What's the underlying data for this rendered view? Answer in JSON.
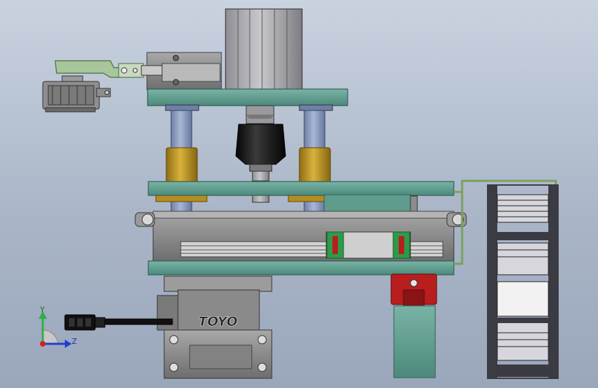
{
  "scene": {
    "brand_label": "TOYO",
    "triad": {
      "y_label": "Y",
      "z_label": "Z"
    },
    "colors": {
      "background_top": "#c9d2df",
      "background_bottom": "#9aa6ba",
      "plate_teal": "#5c9a8c",
      "plate_edge": "#2f5f55",
      "metal_gray": "#8c8c8c",
      "rod_blue": "#8fa0c4",
      "bushing_gold": "#c39a2c",
      "chuck_black": "#141414",
      "block_red": "#b81e1e",
      "accent_green": "#2f9a4a",
      "clamp_green": "#a7c79a",
      "axis_y": "#2fb04a",
      "axis_z": "#2040d0",
      "axis_x": "#d02020"
    }
  }
}
